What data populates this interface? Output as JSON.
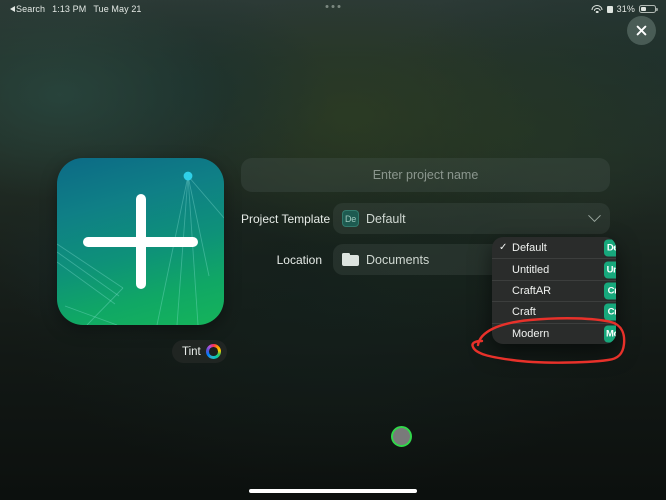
{
  "statusbar": {
    "back_label": "Search",
    "time": "1:13 PM",
    "date": "Tue May 21",
    "battery_percent": "31%",
    "wifi_icon": "wifi-icon",
    "lock_icon": "lock-icon",
    "battery_icon": "battery-icon"
  },
  "window": {
    "close_icon": "close-icon",
    "multitask_handle": "multitask-handle"
  },
  "thumbnail": {
    "icon": "plus-icon",
    "gradient_start": "#0c6a86",
    "gradient_end": "#15b45a"
  },
  "tint": {
    "label": "Tint",
    "wheel_icon": "color-wheel-icon"
  },
  "form": {
    "name_placeholder": "Enter project name",
    "name_value": "",
    "template": {
      "label": "Project Template",
      "value": "Default",
      "icon_text": "De",
      "chevron_icon": "chevron-down-icon"
    },
    "location": {
      "label": "Location",
      "value": "Documents",
      "icon": "folder-icon"
    }
  },
  "dropdown": {
    "items": [
      {
        "label": "Default",
        "badge": "De",
        "checked": true,
        "check": "✓"
      },
      {
        "label": "Untitled",
        "badge": "Un",
        "checked": false,
        "check": ""
      },
      {
        "label": "CraftAR",
        "badge": "Cr",
        "checked": false,
        "check": ""
      },
      {
        "label": "Craft",
        "badge": "Cr",
        "checked": false,
        "check": ""
      },
      {
        "label": "Modern",
        "badge": "Mo",
        "checked": false,
        "check": ""
      }
    ],
    "badge_color": "#17a87c"
  },
  "annotation": {
    "shape": "hand-drawn-ellipse",
    "color": "#e8312a",
    "targets": "Modern"
  },
  "touch_indicator": {
    "ring_color": "#32d74b",
    "fill_color": "#808080"
  }
}
